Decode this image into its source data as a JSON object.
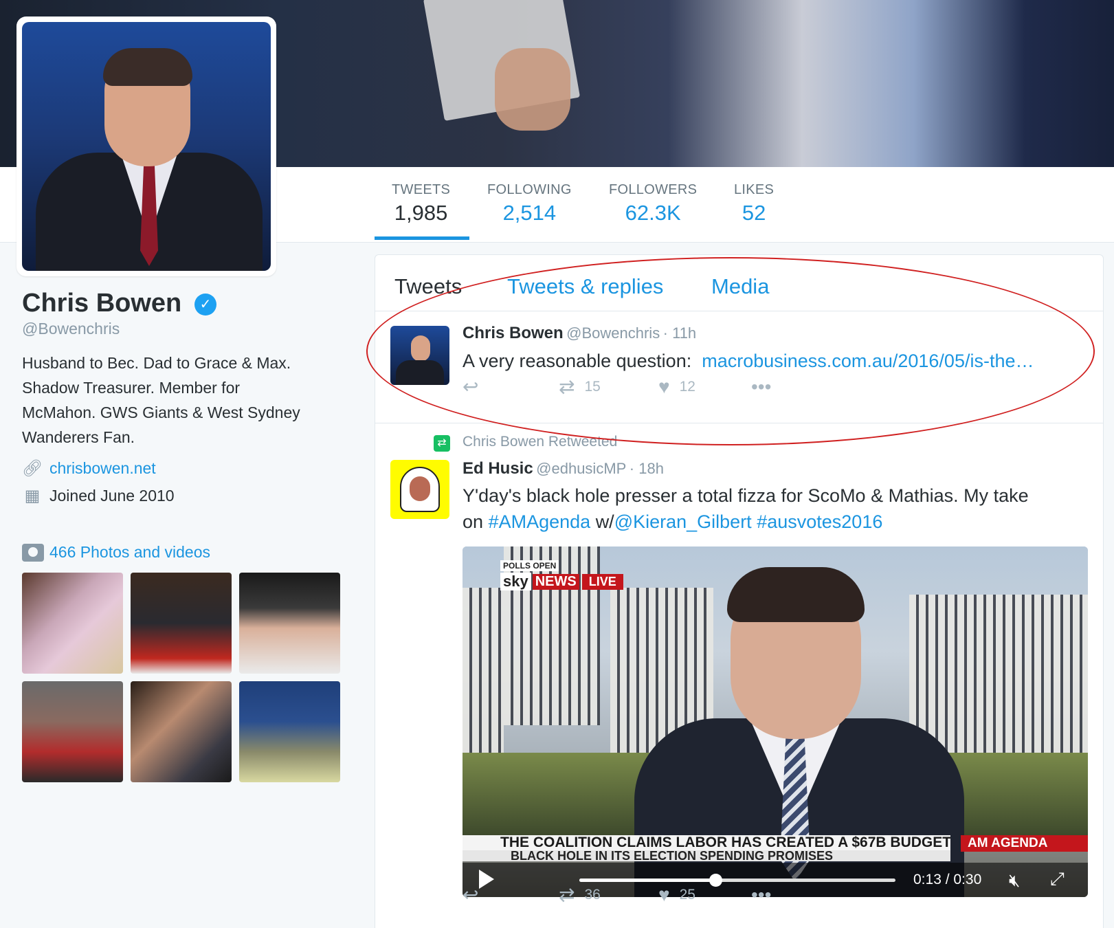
{
  "profile": {
    "name": "Chris Bowen",
    "handle": "@Bowenchris",
    "bio": [
      "Husband to Bec. Dad to Grace & Max.",
      "Shadow Treasurer. Member for",
      "McMahon. GWS Giants & West Sydney",
      "Wanderers Fan."
    ],
    "website": "chrisbowen.net",
    "joined": "Joined June 2010",
    "photos_label": "466 Photos and videos"
  },
  "stats": {
    "tweets": {
      "label": "TWEETS",
      "value": "1,985"
    },
    "following": {
      "label": "FOLLOWING",
      "value": "2,514"
    },
    "followers": {
      "label": "FOLLOWERS",
      "value": "62.3K"
    },
    "likes": {
      "label": "LIKES",
      "value": "52"
    }
  },
  "tabs": {
    "tweets": "Tweets",
    "replies": "Tweets & replies",
    "media": "Media"
  },
  "tweet1": {
    "name": "Chris Bowen",
    "handle": "@Bowenchris",
    "time": "· 11h",
    "text": "A very reasonable question:",
    "link": "macrobusiness.com.au/2016/05/is-the…",
    "retweets": "15",
    "likes": "12"
  },
  "tweet2": {
    "retweeted_by": "Chris Bowen Retweeted",
    "name": "Ed Husic",
    "handle": "@edhusicMP",
    "time": "· 18h",
    "line1": "Y'day's black hole presser a total fizza for ScoMo & Mathias. My take",
    "line2_prefix": "on",
    "hashtag1": "#AMAgenda",
    "w": "w/",
    "mention": "@Kieran_Gilbert",
    "hashtag2": "#ausvotes2016",
    "retweets": "36",
    "likes": "25"
  },
  "video": {
    "polls": "POLLS OPEN",
    "sky": "sky",
    "news": "NEWS",
    "live": "LIVE",
    "ticker1": "THE COALITION CLAIMS LABOR HAS CREATED A $67B BUDGET",
    "ticker2": "BLACK HOLE IN ITS ELECTION SPENDING PROMISES",
    "program": "AM AGENDA",
    "time": "0:13 / 0:30",
    "progress": 0.43
  },
  "colors": {
    "accent": "#1b95e0",
    "retweet": "#17bf63",
    "annotation": "#d02020"
  }
}
